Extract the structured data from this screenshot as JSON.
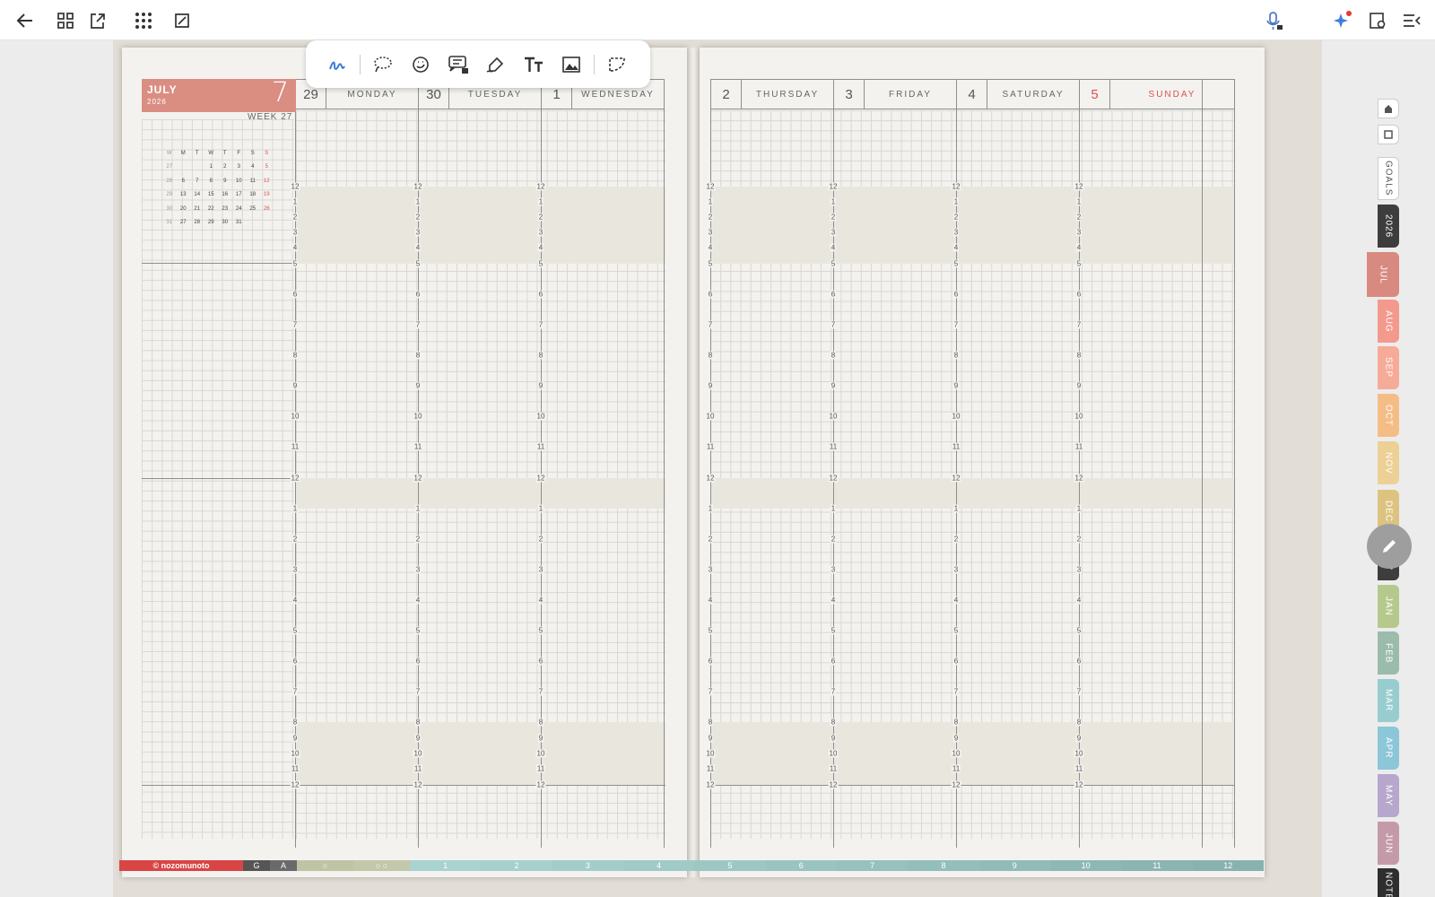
{
  "left_page": {
    "month": "JULY",
    "year": "2026",
    "week_badge": "7",
    "week_label": "WEEK 27",
    "calendar": {
      "headers": [
        "W",
        "M",
        "T",
        "W",
        "T",
        "F",
        "S",
        "S"
      ],
      "rows": [
        [
          "27",
          "",
          "",
          "1",
          "2",
          "3",
          "4",
          "5"
        ],
        [
          "28",
          "6",
          "7",
          "8",
          "9",
          "10",
          "11",
          "12"
        ],
        [
          "29",
          "13",
          "14",
          "15",
          "16",
          "17",
          "18",
          "19"
        ],
        [
          "30",
          "20",
          "21",
          "22",
          "23",
          "24",
          "25",
          "26"
        ],
        [
          "31",
          "27",
          "28",
          "29",
          "30",
          "31",
          "",
          ""
        ]
      ]
    },
    "days": [
      {
        "num": "29",
        "label": "MONDAY"
      },
      {
        "num": "30",
        "label": "TUESDAY"
      },
      {
        "num": "1",
        "label": "WEDNESDAY"
      }
    ]
  },
  "right_page": {
    "days": [
      {
        "num": "2",
        "label": "THURSDAY"
      },
      {
        "num": "3",
        "label": "FRIDAY"
      },
      {
        "num": "4",
        "label": "SATURDAY"
      },
      {
        "num": "5",
        "label": "SUNDAY"
      }
    ]
  },
  "hours": [
    "12",
    "1",
    "2",
    "3",
    "4",
    "5",
    "6",
    "7",
    "8",
    "9",
    "10",
    "11",
    "12",
    "1",
    "2",
    "3",
    "4",
    "5",
    "6",
    "7",
    "8",
    "9",
    "10",
    "11",
    "12"
  ],
  "side_tabs": [
    {
      "label": "GOALS",
      "color": "#ffffff",
      "text": "#555555"
    },
    {
      "label": "2026",
      "color": "#3d3d3d",
      "text": "#ffffff"
    },
    {
      "label": "JUL",
      "color": "#d98a80",
      "text": "#ffffff"
    },
    {
      "label": "AUG",
      "color": "#f39a8c",
      "text": "#ffffff"
    },
    {
      "label": "SEP",
      "color": "#f6ab98",
      "text": "#ffffff"
    },
    {
      "label": "OCT",
      "color": "#f5bd86",
      "text": "#ffffff"
    },
    {
      "label": "NOV",
      "color": "#ecd095",
      "text": "#ffffff"
    },
    {
      "label": "DEC",
      "color": "#dcc480",
      "text": "#ffffff"
    },
    {
      "label": "2027",
      "color": "#3d3d3d",
      "text": "#ffffff"
    },
    {
      "label": "JAN",
      "color": "#b5c98d",
      "text": "#ffffff"
    },
    {
      "label": "FEB",
      "color": "#9bbcac",
      "text": "#ffffff"
    },
    {
      "label": "MAR",
      "color": "#98cdd0",
      "text": "#ffffff"
    },
    {
      "label": "APR",
      "color": "#8cc6d9",
      "text": "#ffffff"
    },
    {
      "label": "MAY",
      "color": "#b7a7cc",
      "text": "#ffffff"
    },
    {
      "label": "JUN",
      "color": "#c49aa9",
      "text": "#ffffff"
    },
    {
      "label": "NOTES",
      "color": "#2e2e2e",
      "text": "#ffffff"
    }
  ],
  "footer": {
    "brand": "© nozomunoto",
    "items": [
      "G",
      "A",
      "○",
      "○ ○",
      "1",
      "2",
      "3",
      "4",
      "5",
      "6",
      "7",
      "8",
      "9",
      "10",
      "11",
      "12"
    ]
  },
  "colors": {
    "accent": "#da8e82",
    "sunday": "#d9534f"
  }
}
